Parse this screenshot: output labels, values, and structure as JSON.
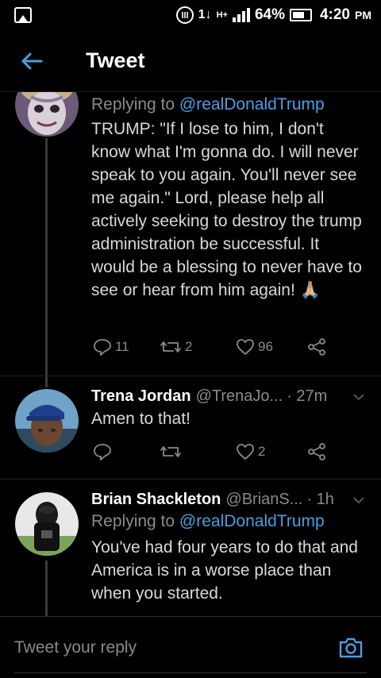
{
  "status_bar": {
    "signal_label": "1↓",
    "network_label": "H+",
    "battery_percent": "64%",
    "time": "4:20",
    "ampm": "PM"
  },
  "header": {
    "title": "Tweet"
  },
  "tweets": [
    {
      "reply_prefix": "Replying to ",
      "reply_mention": "@realDonaldTrump",
      "text": "TRUMP: \"If I lose to him, I don't know what I'm gonna do. I will never speak to you again. You'll never see me again.\" Lord, please help all actively seeking to destroy the trump administration be successful. It would be a blessing to never have to see or hear from him again! 🙏🏼",
      "replies": "11",
      "retweets": "2",
      "likes": "96"
    },
    {
      "name": "Trena Jordan",
      "handle": "@TrenaJo...",
      "time": "· 27m",
      "text": "Amen to that!",
      "likes": "2"
    },
    {
      "name": "Brian Shackleton",
      "handle": "@BrianS...",
      "time": "· 1h",
      "reply_prefix": "Replying to ",
      "reply_mention": "@realDonaldTrump",
      "text": "You've had four years to do that and America is in a worse place than when you started."
    }
  ],
  "reply_bar": {
    "placeholder": "Tweet your reply"
  },
  "colors": {
    "accent": "#4a9fe0",
    "background": "#000000",
    "muted": "#8a8a8a"
  }
}
